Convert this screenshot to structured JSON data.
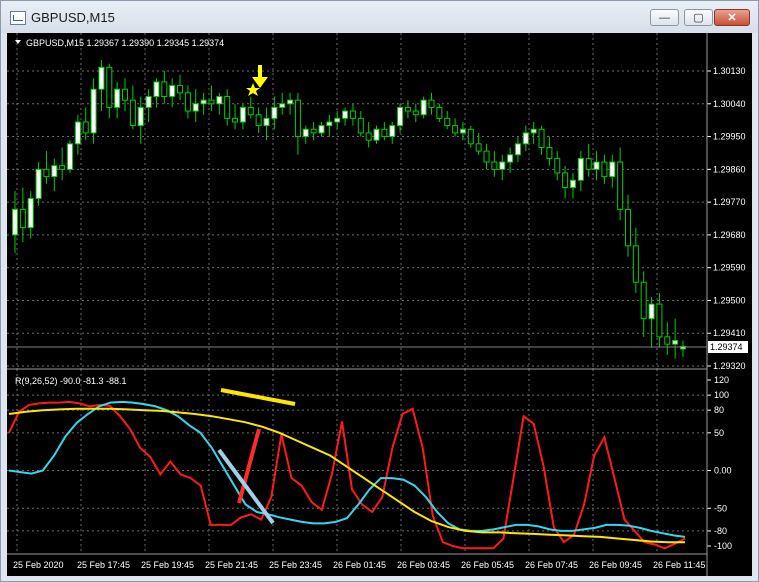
{
  "window": {
    "title": "GBPUSD,M15",
    "buttons": {
      "minimize": "—",
      "maximize": "▢",
      "close": "✕"
    }
  },
  "main_panel": {
    "header_text": "GBPUSD,M15  1.29367 1.29390 1.29345 1.29374",
    "current_price": "1.29374",
    "arrow_marker": "down-arrow",
    "star_marker": "star"
  },
  "indicator_panel": {
    "header_text": "R(9,26,52) -90.0 -81.3 -88.1"
  },
  "colors": {
    "background": "#000000",
    "grid": "#6e6e6e",
    "bull_candle": "#ffffff",
    "bear_candle": "#000000",
    "wick": "#00d000",
    "fast_line": "#ff1a1a",
    "medium_line": "#33d7f0",
    "slow_line": "#ffe600",
    "marker": "#ffff00"
  },
  "chart_data": [
    {
      "type": "candlestick",
      "title": "GBPUSD,M15",
      "y_ticks": [
        "1.30130",
        "1.30040",
        "1.29950",
        "1.29860",
        "1.29770",
        "1.29680",
        "1.29590",
        "1.29500",
        "1.29410",
        "1.29320"
      ],
      "ylim": [
        1.2932,
        1.3015
      ],
      "x_ticks": [
        "25 Feb 2020",
        "25 Feb 17:45",
        "25 Feb 19:45",
        "25 Feb 21:45",
        "25 Feb 23:45",
        "26 Feb 01:45",
        "26 Feb 03:45",
        "26 Feb 05:45",
        "26 Feb 07:45",
        "26 Feb 09:45",
        "26 Feb 11:45"
      ],
      "grid": true,
      "last_price": 1.29374,
      "ohlc": [
        [
          1.2968,
          1.298,
          1.2963,
          1.2975
        ],
        [
          1.2975,
          1.2981,
          1.2966,
          1.297
        ],
        [
          1.297,
          1.298,
          1.2967,
          1.2978
        ],
        [
          1.2978,
          1.2988,
          1.2976,
          1.2986
        ],
        [
          1.2986,
          1.2991,
          1.2982,
          1.2984
        ],
        [
          1.2984,
          1.2989,
          1.298,
          1.2987
        ],
        [
          1.2987,
          1.2992,
          1.2983,
          1.2986
        ],
        [
          1.2986,
          1.2994,
          1.2985,
          1.2993
        ],
        [
          1.2993,
          1.3001,
          1.299,
          1.2999
        ],
        [
          1.2999,
          1.3003,
          1.2994,
          1.2996
        ],
        [
          1.2996,
          1.3011,
          1.2993,
          1.3008
        ],
        [
          1.3008,
          1.3016,
          1.3002,
          1.3014
        ],
        [
          1.3014,
          1.3015,
          1.3,
          1.3003
        ],
        [
          1.3003,
          1.301,
          1.3,
          1.3008
        ],
        [
          1.3008,
          1.3011,
          1.3002,
          1.3005
        ],
        [
          1.3005,
          1.3009,
          1.2997,
          1.2998
        ],
        [
          1.2998,
          1.3006,
          1.2993,
          1.3003
        ],
        [
          1.3003,
          1.3008,
          1.2999,
          1.3006
        ],
        [
          1.3006,
          1.3011,
          1.3003,
          1.301
        ],
        [
          1.301,
          1.3013,
          1.3004,
          1.3006
        ],
        [
          1.3006,
          1.3011,
          1.3003,
          1.3009
        ],
        [
          1.3009,
          1.3012,
          1.3005,
          1.3007
        ],
        [
          1.3007,
          1.3009,
          1.3,
          1.3002
        ],
        [
          1.3002,
          1.3008,
          1.2999,
          1.3004
        ],
        [
          1.3004,
          1.3007,
          1.3001,
          1.3005
        ],
        [
          1.3005,
          1.3009,
          1.3002,
          1.3004
        ],
        [
          1.3004,
          1.3007,
          1.3001,
          1.3006
        ],
        [
          1.3006,
          1.3008,
          1.2998,
          1.3
        ],
        [
          1.3,
          1.3004,
          1.2997,
          1.2999
        ],
        [
          1.2999,
          1.3004,
          1.2997,
          1.3003
        ],
        [
          1.3003,
          1.3006,
          1.3,
          1.3001
        ],
        [
          1.3001,
          1.3003,
          1.2996,
          1.2998
        ],
        [
          1.2998,
          1.3003,
          1.2994,
          1.3
        ],
        [
          1.3,
          1.3006,
          1.2997,
          1.3003
        ],
        [
          1.3003,
          1.3007,
          1.3001,
          1.3004
        ],
        [
          1.3004,
          1.3007,
          1.3001,
          1.3005
        ],
        [
          1.3005,
          1.3007,
          1.299,
          1.2995
        ],
        [
          1.2995,
          1.2998,
          1.2993,
          1.2997
        ],
        [
          1.2997,
          1.2999,
          1.2994,
          1.2996
        ],
        [
          1.2996,
          1.2999,
          1.2995,
          1.2998
        ],
        [
          1.2998,
          1.3001,
          1.2995,
          1.2999
        ],
        [
          1.2999,
          1.3002,
          1.2997,
          1.3
        ],
        [
          1.3,
          1.3003,
          1.2998,
          1.3002
        ],
        [
          1.3002,
          1.3004,
          1.2998,
          1.3
        ],
        [
          1.3,
          1.3002,
          1.2995,
          1.2996
        ],
        [
          1.2996,
          1.2999,
          1.2992,
          1.2994
        ],
        [
          1.2994,
          1.2998,
          1.2993,
          1.2997
        ],
        [
          1.2997,
          1.2999,
          1.2994,
          1.2995
        ],
        [
          1.2995,
          1.2999,
          1.2993,
          1.2998
        ],
        [
          1.2998,
          1.3004,
          1.2996,
          1.3003
        ],
        [
          1.3003,
          1.3005,
          1.3,
          1.3002
        ],
        [
          1.3002,
          1.3004,
          1.2999,
          1.3001
        ],
        [
          1.3001,
          1.3006,
          1.3,
          1.3005
        ],
        [
          1.3005,
          1.3007,
          1.3001,
          1.3003
        ],
        [
          1.3003,
          1.3004,
          1.2999,
          1.3
        ],
        [
          1.3,
          1.3002,
          1.2997,
          1.2998
        ],
        [
          1.2998,
          1.3,
          1.2995,
          1.2996
        ],
        [
          1.2996,
          1.2999,
          1.2994,
          1.2997
        ],
        [
          1.2997,
          1.2998,
          1.2992,
          1.2993
        ],
        [
          1.2993,
          1.2996,
          1.299,
          1.2991
        ],
        [
          1.2991,
          1.2993,
          1.2986,
          1.2988
        ],
        [
          1.2988,
          1.2991,
          1.2984,
          1.2986
        ],
        [
          1.2986,
          1.299,
          1.2983,
          1.2988
        ],
        [
          1.2988,
          1.2992,
          1.2985,
          1.299
        ],
        [
          1.299,
          1.2995,
          1.2988,
          1.2993
        ],
        [
          1.2993,
          1.2998,
          1.2991,
          1.2996
        ],
        [
          1.2996,
          1.2999,
          1.2993,
          1.2997
        ],
        [
          1.2997,
          1.2998,
          1.299,
          1.2992
        ],
        [
          1.2992,
          1.2995,
          1.2987,
          1.2989
        ],
        [
          1.2989,
          1.2991,
          1.2983,
          1.2985
        ],
        [
          1.2985,
          1.2987,
          1.2978,
          1.2981
        ],
        [
          1.2981,
          1.2985,
          1.2978,
          1.2983
        ],
        [
          1.2983,
          1.2991,
          1.298,
          1.2989
        ],
        [
          1.2989,
          1.2993,
          1.2984,
          1.2986
        ],
        [
          1.2986,
          1.2991,
          1.2983,
          1.2988
        ],
        [
          1.2988,
          1.299,
          1.2982,
          1.2984
        ],
        [
          1.2984,
          1.299,
          1.2981,
          1.2988
        ],
        [
          1.2988,
          1.2992,
          1.2972,
          1.2975
        ],
        [
          1.2975,
          1.2979,
          1.2962,
          1.2965
        ],
        [
          1.2965,
          1.297,
          1.2952,
          1.2955
        ],
        [
          1.2955,
          1.2958,
          1.294,
          1.2945
        ],
        [
          1.2945,
          1.2951,
          1.2937,
          1.2949
        ],
        [
          1.2949,
          1.2952,
          1.2937,
          1.294
        ],
        [
          1.294,
          1.2944,
          1.2935,
          1.2938
        ],
        [
          1.2938,
          1.2945,
          1.2934,
          1.2939
        ],
        [
          1.29367,
          1.2939,
          1.29345,
          1.29374
        ]
      ]
    },
    {
      "type": "line",
      "title": "R(9,26,52)",
      "y_ticks": [
        "120",
        "100",
        "80",
        "50",
        "0.00",
        "-50",
        "-80",
        "-100"
      ],
      "ylim": [
        -110,
        130
      ],
      "series": [
        {
          "values": [
            50,
            78,
            87,
            89,
            90,
            90,
            91,
            89,
            85,
            87,
            86,
            72,
            55,
            30,
            18,
            -5,
            12,
            -5,
            -10,
            -20,
            -72,
            -72,
            -72,
            -62,
            -58,
            -65,
            -35,
            48,
            -10,
            -20,
            -42,
            -52,
            -5,
            65,
            -25,
            -45,
            -55,
            -35,
            30,
            75,
            82,
            30,
            -60,
            -95,
            -100,
            -103,
            -103,
            -103,
            -103,
            -90,
            -10,
            72,
            62,
            5,
            -75,
            -95,
            -85,
            -45,
            20,
            44,
            -10,
            -65,
            -80,
            -95,
            -98,
            -103,
            -97,
            -90
          ]
        },
        {
          "values": [
            0,
            -2,
            -4,
            0,
            20,
            45,
            63,
            75,
            85,
            90,
            91,
            90,
            88,
            85,
            80,
            72,
            60,
            50,
            30,
            5,
            -20,
            -45,
            -55,
            -58,
            -62,
            -65,
            -68,
            -70,
            -70,
            -68,
            -63,
            -45,
            -25,
            -10,
            -10,
            -12,
            -20,
            -35,
            -55,
            -70,
            -78,
            -80,
            -80,
            -78,
            -75,
            -72,
            -72,
            -74,
            -78,
            -80,
            -80,
            -78,
            -76,
            -72,
            -72,
            -73,
            -76,
            -80,
            -83,
            -86,
            -88
          ]
        },
        {
          "values": [
            75,
            78,
            80,
            81,
            82,
            82,
            82,
            81,
            80,
            79,
            77,
            75,
            72,
            68,
            64,
            58,
            50,
            40,
            30,
            20,
            5,
            -10,
            -25,
            -40,
            -55,
            -67,
            -75,
            -80,
            -82,
            -82,
            -83,
            -84,
            -85,
            -86,
            -87,
            -88,
            -90,
            -92,
            -94,
            -95,
            -95
          ]
        }
      ],
      "annotations": [
        "yellow trendline",
        "red trendline",
        "light-blue trendline"
      ]
    }
  ]
}
